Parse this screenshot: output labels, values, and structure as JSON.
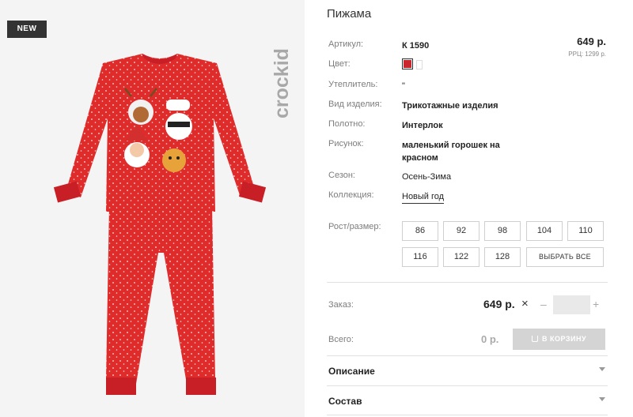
{
  "badge": "NEW",
  "brand": "crockid",
  "product": {
    "title": "Пижама",
    "price": "649 р.",
    "rrp": "РРЦ: 1299 р.",
    "attributes": [
      {
        "label": "Артикул:",
        "value": "К 1590"
      },
      {
        "label": "Цвет:",
        "value": ""
      },
      {
        "label": "Утеплитель:",
        "value": "\""
      },
      {
        "label": "Вид изделия:",
        "value": "Трикотажные изделия"
      },
      {
        "label": "Полотно:",
        "value": "Интерлок"
      },
      {
        "label": "Рисунок:",
        "value": "маленький горошек на красном"
      },
      {
        "label": "Сезон:",
        "value": "Осень-Зима"
      },
      {
        "label": "Коллекция:",
        "value": "Новый год"
      }
    ],
    "color_selected": "#c9262d"
  },
  "sizes": {
    "label": "Рост/размер:",
    "options": [
      "86",
      "92",
      "98",
      "104",
      "110",
      "116",
      "122",
      "128"
    ],
    "select_all": "ВЫБРАТЬ ВСЕ"
  },
  "order": {
    "label": "Заказ:",
    "price": "649 р.",
    "times": "×",
    "minus": "–",
    "plus": "+",
    "qty": "",
    "total_label": "Всего:",
    "total": "0 р.",
    "cart_button": "В КОРЗИНУ"
  },
  "accordion": [
    "Описание",
    "Состав"
  ]
}
